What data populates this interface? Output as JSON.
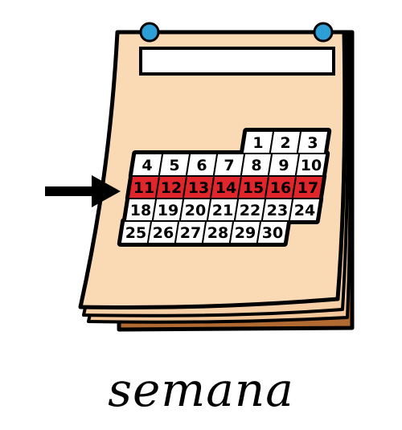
{
  "pictogram": {
    "caption": "semana",
    "colors": {
      "page": "#FAD9B5",
      "back_page": "#F3C79A",
      "back_cover": "#B06A32",
      "outline": "#000000",
      "highlight_row": "#E0262B",
      "pin": "#2E9FD6"
    },
    "icon": "arrow-right-icon"
  },
  "calendar": {
    "weeks": [
      [
        "",
        "",
        "",
        "",
        "1",
        "2",
        "3"
      ],
      [
        "4",
        "5",
        "6",
        "7",
        "8",
        "9",
        "10"
      ],
      [
        "11",
        "12",
        "13",
        "14",
        "15",
        "16",
        "17"
      ],
      [
        "18",
        "19",
        "20",
        "21",
        "22",
        "23",
        "24"
      ],
      [
        "25",
        "26",
        "27",
        "28",
        "29",
        "30",
        ""
      ]
    ],
    "highlighted_week_index": 2
  }
}
